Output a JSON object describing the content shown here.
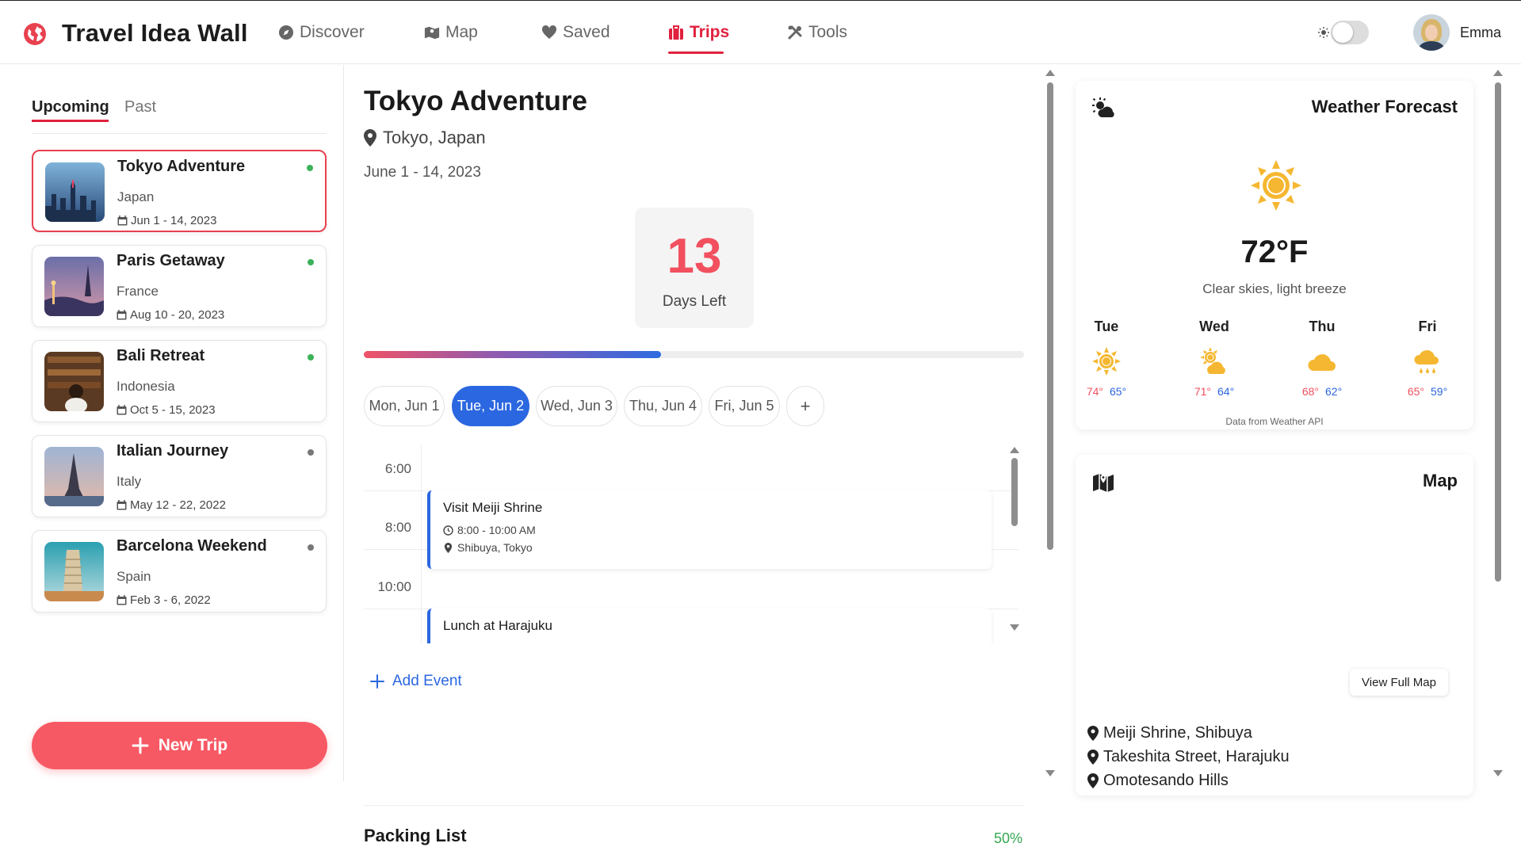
{
  "app": {
    "title": "Travel Idea Wall",
    "accent_color": "#e0213e"
  },
  "nav": [
    {
      "label": "Discover",
      "icon": "compass-icon"
    },
    {
      "label": "Map",
      "icon": "map-icon"
    },
    {
      "label": "Saved",
      "icon": "heart-icon"
    },
    {
      "label": "Trips",
      "icon": "suitcase-icon",
      "active": true
    },
    {
      "label": "Tools",
      "icon": "tools-icon"
    }
  ],
  "user": {
    "name": "Emma",
    "theme_toggle": "off"
  },
  "sidebar": {
    "tabs": [
      {
        "label": "Upcoming",
        "active": true
      },
      {
        "label": "Past"
      }
    ],
    "trips": [
      {
        "name": "Tokyo Adventure",
        "country": "Japan",
        "dates": "Jun 1 - 14, 2023",
        "status": "upcoming",
        "status_color": "#3cb25a",
        "selected": true
      },
      {
        "name": "Paris Getaway",
        "country": "France",
        "dates": "Aug 10 - 20, 2023",
        "status": "upcoming",
        "status_color": "#3cb25a"
      },
      {
        "name": "Bali Retreat",
        "country": "Indonesia",
        "dates": "Oct 5 - 15, 2023",
        "status": "upcoming",
        "status_color": "#3cb25a"
      },
      {
        "name": "Italian Journey",
        "country": "Italy",
        "dates": "May 12 - 22, 2022",
        "status": "past",
        "status_color": "#777777"
      },
      {
        "name": "Barcelona Weekend",
        "country": "Spain",
        "dates": "Feb 3 - 6, 2022",
        "status": "past",
        "status_color": "#777777"
      }
    ],
    "new_trip_label": "New Trip"
  },
  "main": {
    "title": "Tokyo Adventure",
    "location": "Tokyo, Japan",
    "date_range": "June 1 - 14, 2023",
    "countdown": {
      "value": "13",
      "label": "Days Left"
    },
    "progress_fraction": 0.45,
    "days": [
      {
        "label": "Mon, Jun 1"
      },
      {
        "label": "Tue, Jun 2",
        "active": true
      },
      {
        "label": "Wed, Jun 3"
      },
      {
        "label": "Thu, Jun 4"
      },
      {
        "label": "Fri, Jun 5"
      }
    ],
    "add_day_label": "+",
    "times": [
      "6:00",
      "8:00",
      "10:00"
    ],
    "events": [
      {
        "title": "Visit Meiji Shrine",
        "time": "8:00 - 10:00 AM",
        "place": "Shibuya, Tokyo"
      },
      {
        "title": "Lunch at Harajuku"
      }
    ],
    "add_event_label": "Add Event",
    "packing": {
      "title": "Packing List",
      "percent": "50%"
    }
  },
  "weather": {
    "title": "Weather Forecast",
    "current_icon": "sun-icon",
    "temp": "72°F",
    "description": "Clear skies, light breeze",
    "forecast": [
      {
        "day": "Tue",
        "icon": "sun-icon",
        "hi": "74°",
        "lo": "65°"
      },
      {
        "day": "Wed",
        "icon": "sun-cloud-icon",
        "hi": "71°",
        "lo": "64°"
      },
      {
        "day": "Thu",
        "icon": "cloud-icon",
        "hi": "68°",
        "lo": "62°"
      },
      {
        "day": "Fri",
        "icon": "rain-icon",
        "hi": "65°",
        "lo": "59°"
      }
    ],
    "source": "Data from Weather API"
  },
  "map": {
    "title": "Map",
    "view_button": "View Full Map",
    "places": [
      "Meiji Shrine, Shibuya",
      "Takeshita Street, Harajuku",
      "Omotesando Hills"
    ]
  }
}
